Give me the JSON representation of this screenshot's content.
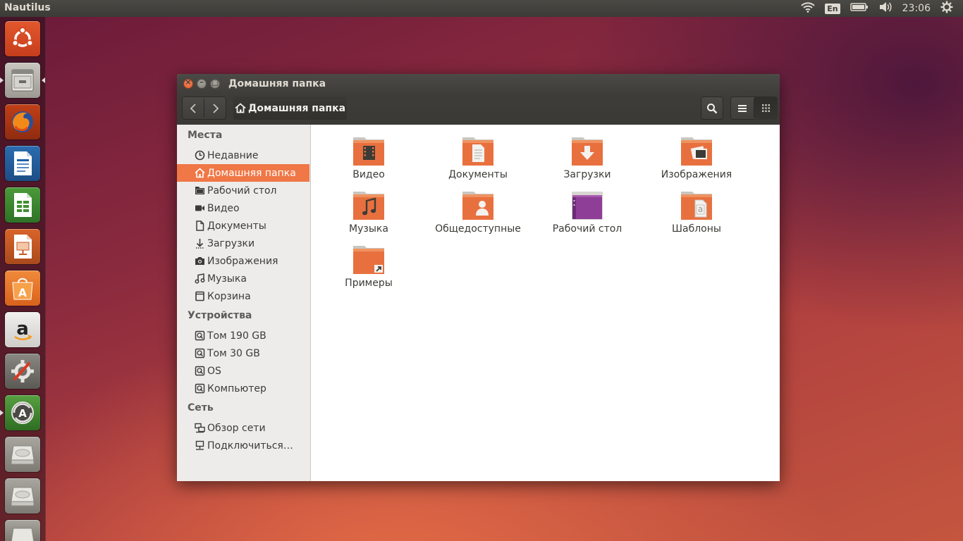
{
  "top_panel": {
    "app_title": "Nautilus",
    "keyboard_layout": "En",
    "clock": "23:06",
    "icons": [
      "wifi-icon",
      "battery-icon",
      "volume-icon",
      "settings-gear-icon"
    ]
  },
  "launcher": {
    "items": [
      {
        "name": "ubuntu-dash",
        "icon": "ubuntu-logo-icon"
      },
      {
        "name": "files",
        "icon": "file-cabinet-icon",
        "running": true
      },
      {
        "name": "firefox",
        "icon": "firefox-icon"
      },
      {
        "name": "libreoffice-writer",
        "icon": "writer-icon"
      },
      {
        "name": "libreoffice-calc",
        "icon": "calc-icon"
      },
      {
        "name": "libreoffice-impress",
        "icon": "impress-icon"
      },
      {
        "name": "ubuntu-software-center",
        "icon": "software-center-icon"
      },
      {
        "name": "amazon",
        "icon": "amazon-icon"
      },
      {
        "name": "system-settings",
        "icon": "system-settings-icon"
      },
      {
        "name": "software-updater",
        "icon": "software-updater-icon",
        "running": true
      },
      {
        "name": "drive-1",
        "icon": "hard-drive-icon"
      },
      {
        "name": "drive-2",
        "icon": "hard-drive-icon"
      },
      {
        "name": "drive-3",
        "icon": "hard-drive-icon"
      }
    ]
  },
  "window": {
    "title": "Домашняя папка",
    "breadcrumb": "Домашняя папка",
    "view_mode": "icons"
  },
  "sidebar": {
    "places_heading": "Места",
    "places": [
      {
        "label": "Недавние",
        "icon": "clock-icon"
      },
      {
        "label": "Домашняя папка",
        "icon": "home-icon",
        "selected": true
      },
      {
        "label": "Рабочий стол",
        "icon": "desktop-folder-icon"
      },
      {
        "label": "Видео",
        "icon": "video-camera-icon"
      },
      {
        "label": "Документы",
        "icon": "document-icon"
      },
      {
        "label": "Загрузки",
        "icon": "download-arrow-icon"
      },
      {
        "label": "Изображения",
        "icon": "camera-icon"
      },
      {
        "label": "Музыка",
        "icon": "music-note-icon"
      },
      {
        "label": "Корзина",
        "icon": "trash-icon"
      }
    ],
    "devices_heading": "Устройства",
    "devices": [
      {
        "label": "Том 190 GB",
        "icon": "drive-icon"
      },
      {
        "label": "Том 30 GB",
        "icon": "drive-icon"
      },
      {
        "label": "OS",
        "icon": "drive-icon"
      },
      {
        "label": "Компьютер",
        "icon": "drive-icon"
      }
    ],
    "network_heading": "Сеть",
    "network": [
      {
        "label": "Обзор сети",
        "icon": "network-icon"
      },
      {
        "label": "Подключиться…",
        "icon": "connect-server-icon"
      }
    ]
  },
  "files": [
    {
      "label": "Видео",
      "icon": "video-folder-icon"
    },
    {
      "label": "Документы",
      "icon": "documents-folder-icon"
    },
    {
      "label": "Загрузки",
      "icon": "downloads-folder-icon"
    },
    {
      "label": "Изображения",
      "icon": "pictures-folder-icon"
    },
    {
      "label": "Музыка",
      "icon": "music-folder-icon"
    },
    {
      "label": "Общедоступные",
      "icon": "public-folder-icon"
    },
    {
      "label": "Рабочий стол",
      "icon": "desktop-folder-icon"
    },
    {
      "label": "Шаблоны",
      "icon": "templates-folder-icon"
    },
    {
      "label": "Примеры",
      "icon": "examples-link-folder-icon"
    }
  ],
  "colors": {
    "accent": "#f07746",
    "panel": "#3c3b37",
    "folder": "#e8703f",
    "desktop_folder": "#8e3e96"
  }
}
